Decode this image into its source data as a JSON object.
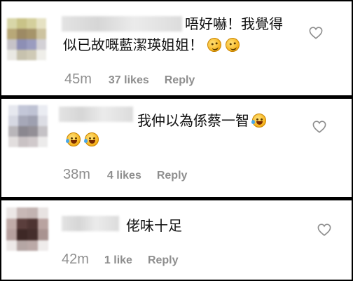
{
  "comments": [
    {
      "text_lines": [
        "唔好嚇！我覺得",
        "似已故嘅藍潔瑛姐姐！"
      ],
      "emojis": [
        "thinking-face",
        "thinking-face"
      ],
      "time": "45m",
      "likes": "37 likes",
      "reply": "Reply"
    },
    {
      "text_lines": [
        "我仲以為係蔡一智"
      ],
      "emojis": [
        "rolling-on-floor-laughing",
        "rolling-on-floor-laughing",
        "rolling-on-floor-laughing"
      ],
      "time": "38m",
      "likes": "4 likes",
      "reply": "Reply"
    },
    {
      "text_lines": [
        "佬味十足"
      ],
      "emojis": [],
      "time": "42m",
      "likes": "1 like",
      "reply": "Reply"
    }
  ],
  "colors": {
    "text": "#111111",
    "meta": "#8e8e8e",
    "divider": "#000000",
    "background": "#ffffff",
    "emoji": "#f6b21b"
  },
  "icons": {
    "like": "heart-outline-icon",
    "emoji_thinking": "thinking-face-emoji",
    "emoji_laugh": "rolling-on-floor-laughing-emoji"
  }
}
